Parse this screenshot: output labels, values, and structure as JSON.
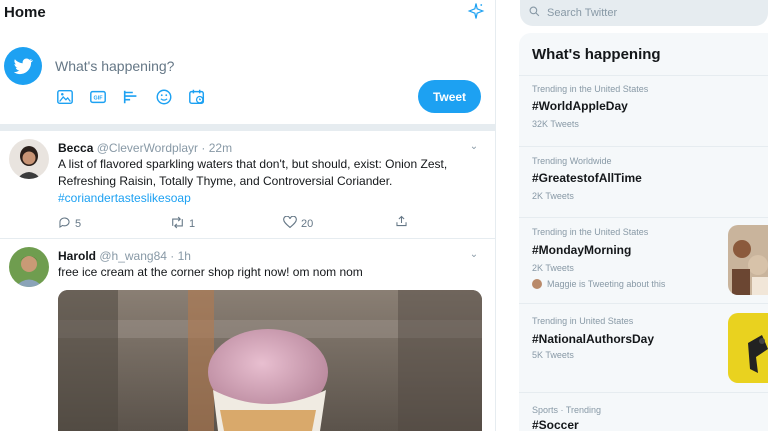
{
  "header": {
    "title": "Home"
  },
  "compose": {
    "placeholder": "What's happening?",
    "tweet_label": "Tweet",
    "icons": [
      "media-icon",
      "gif-icon",
      "poll-icon",
      "emoji-icon",
      "schedule-icon"
    ]
  },
  "tweets": [
    {
      "name": "Becca",
      "handle": "@CleverWordplayr",
      "time": "· 22m",
      "text": "A list of flavored sparkling waters that don't, but should, exist: Onion Zest, Refreshing Raisin, Totally Thyme, and Controversial Coriander.",
      "hashtag": "#coriandertasteslikesoap",
      "replies": "5",
      "retweets": "1",
      "likes": "20"
    },
    {
      "name": "Harold",
      "handle": "@h_wang84",
      "time": "· 1h",
      "text": "free ice cream at the corner shop right now! om nom nom"
    }
  ],
  "sidebar": {
    "search_placeholder": "Search Twitter",
    "panel_title": "What's happening",
    "trends": [
      {
        "context": "Trending in the United States",
        "name": "#WorldAppleDay",
        "count": "32K Tweets"
      },
      {
        "context": "Trending Worldwide",
        "name": "#GreatestofAllTime",
        "count": "2K Tweets"
      },
      {
        "context": "Trending in the United States",
        "name": "#MondayMorning",
        "count": "2K Tweets",
        "social": "Maggie is Tweeting about this"
      },
      {
        "context": "Trending in United States",
        "name": "#NationalAuthorsDay",
        "count": "5K Tweets"
      },
      {
        "context": "Sports · Trending",
        "name": "#Soccer"
      }
    ]
  },
  "colors": {
    "accent": "#1da1f2",
    "divider": "#e6ecf0",
    "muted": "#8899a6",
    "panel": "#f5f8fa"
  }
}
